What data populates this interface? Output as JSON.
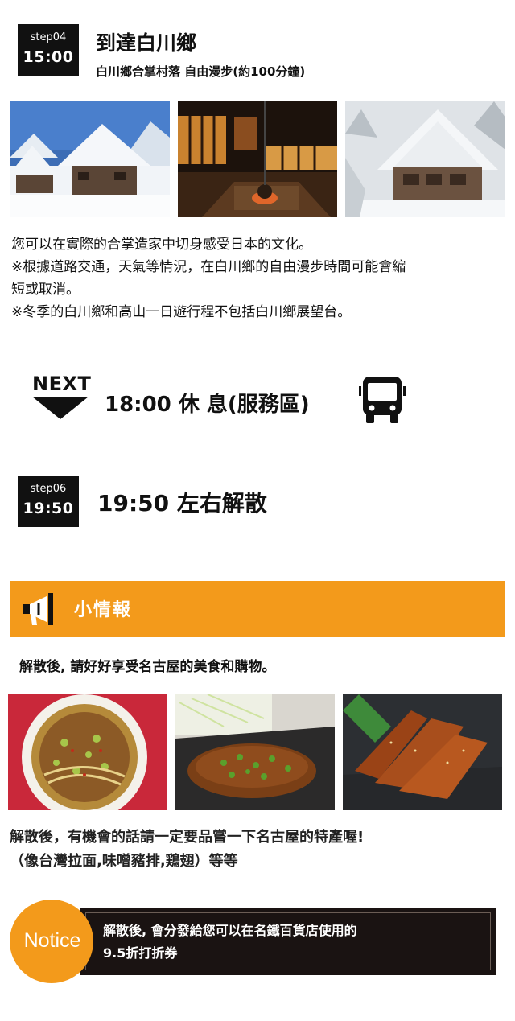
{
  "step04": {
    "label": "step04",
    "time": "15:00",
    "title": "到達白川鄉",
    "subtitle": "白川鄉合掌村落 自由漫步(約100分鐘)"
  },
  "shirakawa_photos": [
    "snow-village-photo",
    "irori-interior-photo",
    "snowy-gassho-house-photo"
  ],
  "description": [
    "您可以在實際的合掌造家中切身感受日本的文化。",
    "※根據道路交通，天氣等情況，在白川鄉的自由漫步時間可能會縮",
    "短或取消。",
    "※冬季的白川鄉和高山一日遊行程不包括白川鄉展望台。"
  ],
  "next": {
    "label": "NEXT",
    "title": "18:00 休 息(服務區)",
    "icon": "bus-icon"
  },
  "step06": {
    "label": "step06",
    "time": "19:50",
    "title": "19:50 左右解散"
  },
  "info": {
    "title": "小情報",
    "icon": "megaphone-icon",
    "accent": "#f39a1b",
    "after_text": "解散後, 請好好享受名古屋的美食和購物。"
  },
  "food_photos": [
    "taiwan-ramen-photo",
    "miso-katsu-photo",
    "chicken-wings-photo"
  ],
  "food_text": [
    "解散後，有機會的話請一定要品嘗一下名古屋的特產喔!",
    "（像台灣拉面,味噌豬排,鶏翅）等等"
  ],
  "notice": {
    "label": "Notice",
    "lines": [
      "解散後, 會分發給您可以在名鐵百貨店使用的",
      "9.5折打折券"
    ],
    "box_color": "#1a1312"
  }
}
